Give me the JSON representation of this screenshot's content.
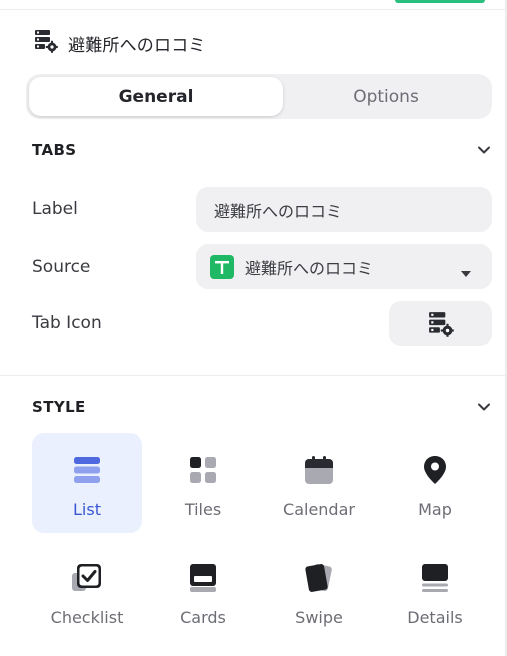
{
  "header": {
    "title": "避難所へのロコミ",
    "icon": "server-gear-icon"
  },
  "tabs": {
    "general": "General",
    "options": "Options",
    "active": "General"
  },
  "tabs_section": {
    "title": "TABS",
    "label": {
      "name": "Label",
      "value": "避難所へのロコミ"
    },
    "source": {
      "name": "Source",
      "value": "避難所へのロコミ",
      "icon": "sheet-icon",
      "icon_color": "#1fb864"
    },
    "tab_icon": {
      "name": "Tab Icon",
      "icon": "server-gear-icon"
    }
  },
  "style_section": {
    "title": "STYLE",
    "selected": "List",
    "items": [
      {
        "label": "List",
        "icon": "list-icon"
      },
      {
        "label": "Tiles",
        "icon": "tiles-icon"
      },
      {
        "label": "Calendar",
        "icon": "calendar-icon"
      },
      {
        "label": "Map",
        "icon": "map-pin-icon"
      },
      {
        "label": "Checklist",
        "icon": "checklist-icon"
      },
      {
        "label": "Cards",
        "icon": "cards-icon"
      },
      {
        "label": "Swipe",
        "icon": "swipe-icon"
      },
      {
        "label": "Details",
        "icon": "details-icon"
      }
    ]
  },
  "colors": {
    "accent": "#3a56d4",
    "selected_bg": "#eaf0fd",
    "field_bg": "#f0f0f2"
  }
}
